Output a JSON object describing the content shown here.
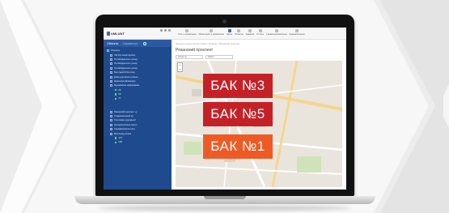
{
  "app": {
    "logo_text": "UMLUNT",
    "menu": [
      {
        "label": "Учет и управление",
        "active": false
      },
      {
        "label": "Мониторинг и управление",
        "active": false
      },
      {
        "label": "Карта",
        "active": true
      },
      {
        "label": "Объекты",
        "active": false
      },
      {
        "label": "Задания",
        "active": false
      },
      {
        "label": "Отчеты",
        "active": false
      },
      {
        "label": "Сервисы/управление",
        "active": false
      },
      {
        "label": "Администрация",
        "active": false
      }
    ]
  },
  "sidebar": {
    "tab_objects": "Объекты",
    "tab_parameters": "Параметры",
    "tree": [
      {
        "label": "Объекты",
        "marker": "box"
      },
      {
        "label": "VIP-Кустовой прибор",
        "marker": "box"
      },
      {
        "label": "По-Мойдинского улице",
        "marker": "box"
      },
      {
        "label": "По-Мойдинского улице",
        "marker": "box"
      },
      {
        "label": "По-Мойдинского улице",
        "marker": "box"
      },
      {
        "label": "Вегетарий Мотоотра",
        "marker": "box"
      },
      {
        "label": "Доме дорожного ремни",
        "marker": "box"
      },
      {
        "label": "Доминиум Доминиум",
        "marker": "box"
      },
      {
        "label": "Муравейник набережная",
        "marker": "box"
      },
      {
        "label": "28",
        "marker": "dot"
      },
      {
        "label": "68",
        "marker": "dot"
      },
      {
        "label": "77",
        "marker": "dot"
      },
      {
        "label": "",
        "marker": "none"
      },
      {
        "label": "",
        "marker": "none"
      },
      {
        "label": "Рязанский проспект ту",
        "marker": "box"
      },
      {
        "label": "Стадиональный пр",
        "marker": "box"
      },
      {
        "label": "Тополевки дорожный",
        "marker": "box"
      },
      {
        "label": "На пересечение многл",
        "marker": "box"
      },
      {
        "label": "Серафимовича-окта",
        "marker": "box"
      },
      {
        "label": "Волгоград-Ахиев",
        "marker": "box"
      },
      {
        "label": "173",
        "marker": "dot"
      },
      {
        "label": "238",
        "marker": "dot"
      }
    ]
  },
  "main": {
    "breadcrumb": "Объекты учета / Карта / Карта / Районы / Рязанский проспект",
    "title": "Рязанский проспект",
    "filter_1": "Объекты",
    "filter_2": "Район",
    "zoom_in": "+",
    "zoom_out": "−"
  },
  "badges": [
    {
      "label": "БАК №3"
    },
    {
      "label": "БАК №5"
    },
    {
      "label": "БАК №1"
    }
  ],
  "colors": {
    "sidebar": "#1f4b8e",
    "badge_red": "#c42127",
    "badge_orange": "#ef5a24"
  }
}
